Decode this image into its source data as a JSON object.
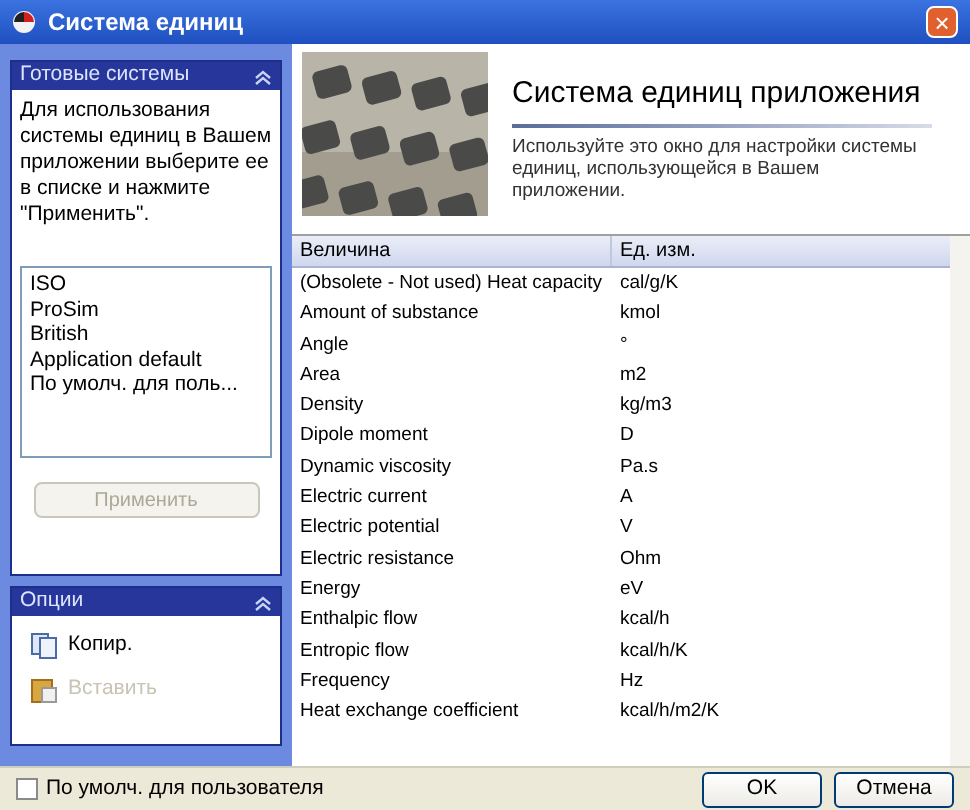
{
  "window": {
    "title": "Система единиц",
    "close": "×"
  },
  "systems_panel": {
    "title": "Готовые системы",
    "expanded": true,
    "description": "Для использования системы единиц в Вашем приложении выберите ее в списке и нажмите \"Применить\".",
    "items": [
      {
        "label": "ISO",
        "selected": false
      },
      {
        "label": "ProSim",
        "selected": false
      },
      {
        "label": "British",
        "selected": false
      },
      {
        "label": "Application default",
        "selected": false
      },
      {
        "label": "По умолч. для поль...",
        "selected": false
      }
    ],
    "apply_button": {
      "label": "Применить",
      "disabled": true
    }
  },
  "options_panel": {
    "title": "Опции",
    "expanded": true,
    "items": [
      {
        "label": "Копир.",
        "kind": "copy",
        "disabled": false
      },
      {
        "label": "Вставить",
        "kind": "paste",
        "disabled": true
      }
    ]
  },
  "header": {
    "title": "Система единиц приложения",
    "description": "Используйте это окно для настройки системы единиц, использующейся в Вашем приложении."
  },
  "table": {
    "columns": [
      "Величина",
      "Ед. изм."
    ],
    "rows": [
      [
        "(Obsolete - Not used) Heat capacity",
        "cal/g/K"
      ],
      [
        "Amount of substance",
        "kmol"
      ],
      [
        "Angle",
        "°"
      ],
      [
        "Area",
        "m2"
      ],
      [
        "Density",
        "kg/m3"
      ],
      [
        "Dipole moment",
        "D"
      ],
      [
        "Dynamic viscosity",
        "Pa.s"
      ],
      [
        "Electric current",
        "A"
      ],
      [
        "Electric potential",
        "V"
      ],
      [
        "Electric resistance",
        "Ohm"
      ],
      [
        "Energy",
        "eV"
      ],
      [
        "Enthalpic flow",
        "kcal/h"
      ],
      [
        "Entropic flow",
        "kcal/h/K"
      ],
      [
        "Frequency",
        "Hz"
      ],
      [
        "Heat exchange coefficient",
        "kcal/h/m2/K"
      ]
    ]
  },
  "footer": {
    "default_checkbox": {
      "label": "По умолч. для пользователя",
      "checked": false
    },
    "buttons": [
      "OK",
      "Отмена"
    ]
  }
}
